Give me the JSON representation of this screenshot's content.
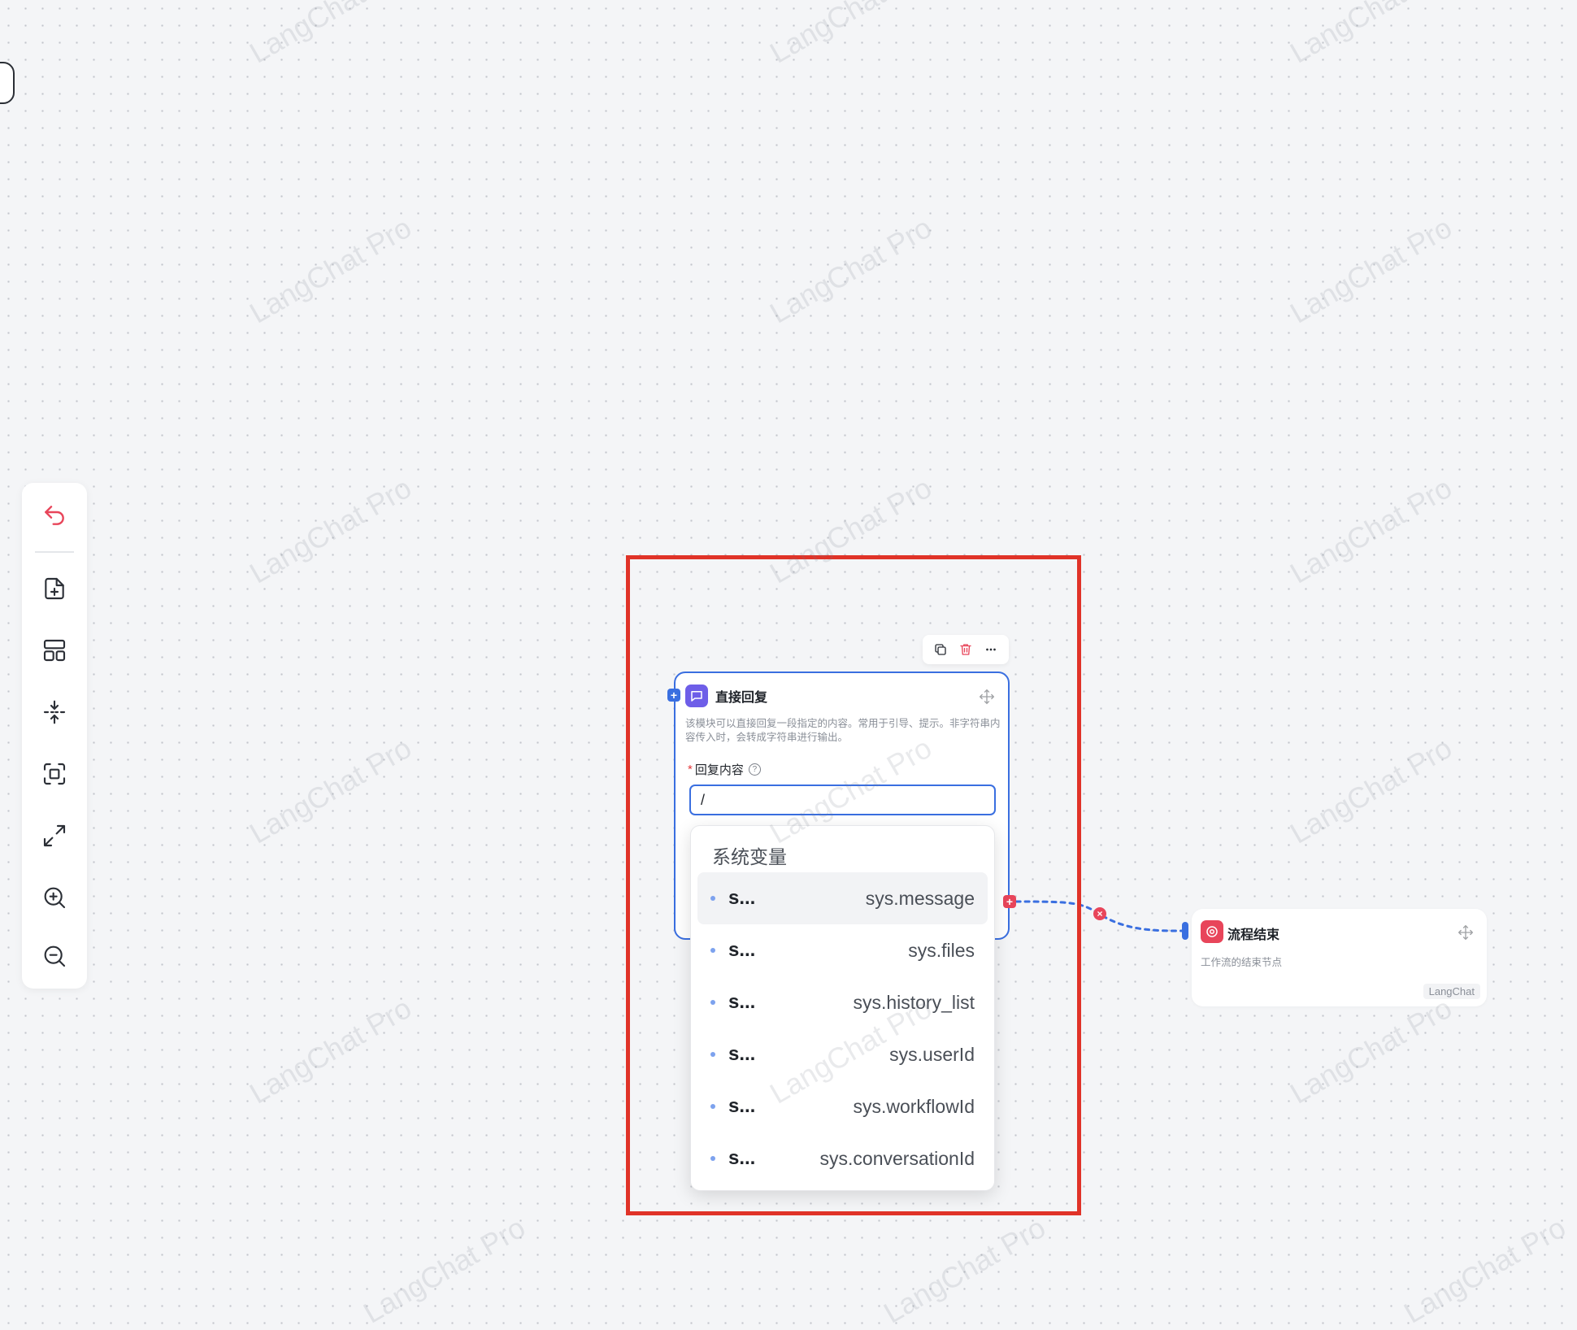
{
  "watermark_text": "LangChat Pro",
  "toolbar": {
    "items": [
      {
        "name": "undo",
        "icon": "undo-icon"
      },
      {
        "name": "add-node",
        "icon": "file-plus-icon"
      },
      {
        "name": "layout",
        "icon": "layout-icon"
      },
      {
        "name": "collapse",
        "icon": "collapse-icon"
      },
      {
        "name": "fit-view",
        "icon": "focus-frame-icon"
      },
      {
        "name": "fullscreen",
        "icon": "expand-icon"
      },
      {
        "name": "zoom-in",
        "icon": "zoom-in-icon"
      },
      {
        "name": "zoom-out",
        "icon": "zoom-out-icon"
      }
    ],
    "accent_color": "#e8455a"
  },
  "reply_node": {
    "title": "直接回复",
    "description": "该模块可以直接回复一段指定的内容。常用于引导、提示。非字符串内容传入时，会转成字符串进行输出。",
    "field_label": "回复内容",
    "field_value": "/",
    "border_color": "#3a6fe0",
    "icon_color": "#6e5ee8"
  },
  "variable_dropdown": {
    "group_label": "系统变量",
    "items": [
      {
        "short": "s...",
        "full": "sys.message",
        "active": true
      },
      {
        "short": "s...",
        "full": "sys.files",
        "active": false
      },
      {
        "short": "s...",
        "full": "sys.history_list",
        "active": false
      },
      {
        "short": "s...",
        "full": "sys.userId",
        "active": false
      },
      {
        "short": "s...",
        "full": "sys.workflowId",
        "active": false
      },
      {
        "short": "s...",
        "full": "sys.conversationId",
        "active": false
      }
    ]
  },
  "end_node": {
    "title": "流程结束",
    "description": "工作流的结束节点",
    "badge": "LangChat",
    "icon_color": "#e8455a"
  },
  "ports": {
    "add_symbol": "+",
    "delete_symbol": "×"
  }
}
